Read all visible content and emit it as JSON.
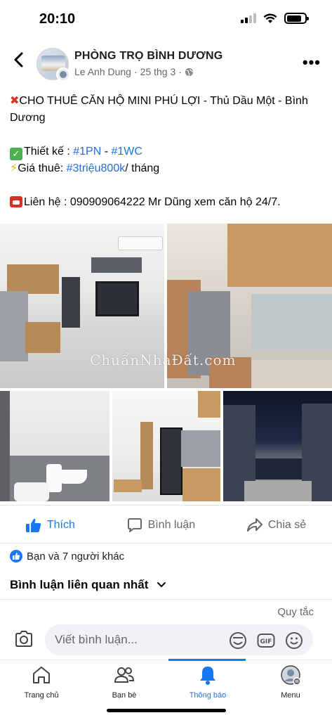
{
  "status": {
    "time": "20:10"
  },
  "post": {
    "group_name": "PHÒNG TRỌ BÌNH DƯƠNG",
    "author": "Le Anh Dung",
    "separator": "·",
    "date": "25 thg 3",
    "lines": {
      "title": "CHO THUÊ CĂN HỘ MINI PHÚ LỢI - Thủ Dầu Một - Bình Dương",
      "design_label": "Thiết kế : ",
      "design_tag1": "#1PN",
      "design_sep": " - ",
      "design_tag2": "#1WC",
      "price_label": "Giá thuê: ",
      "price_tag": "#3triệu800k",
      "price_suffix": "/ tháng",
      "contact": "Liên hệ : 090909064222 Mr Dũng xem căn hộ 24/7."
    },
    "watermark": "ChuẩnNhàĐất.com"
  },
  "actions": {
    "like": "Thích",
    "comment": "Bình luận",
    "share": "Chia sẻ"
  },
  "reactions": {
    "text": "Bạn và 7 người khác"
  },
  "comments": {
    "header": "Bình luận liên quan nhất",
    "rules": "Quy tắc",
    "placeholder": "Viết bình luận..."
  },
  "nav": {
    "items": [
      {
        "label": "Trang chủ",
        "icon": "home-icon"
      },
      {
        "label": "Bạn bè",
        "icon": "friends-icon"
      },
      {
        "label": "Thông báo",
        "icon": "bell-icon",
        "active": true
      },
      {
        "label": "Menu",
        "icon": "menu-avatar-icon"
      }
    ]
  },
  "colors": {
    "accent": "#1877f2",
    "hashtag": "#216fdb",
    "muted": "#65676b"
  }
}
